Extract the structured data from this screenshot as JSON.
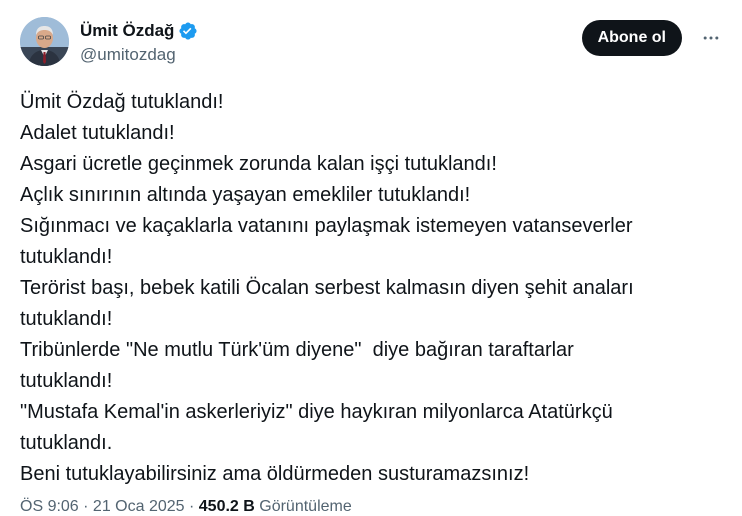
{
  "author": {
    "display_name": "Ümit Özdağ",
    "handle": "@umitozdag",
    "verified": true,
    "verified_color": "#1d9bf0"
  },
  "actions": {
    "follow_label": "Abone ol",
    "more_icon": "more-horizontal-icon"
  },
  "tweet": {
    "lines": [
      "Ümit Özdağ tutuklandı!",
      "Adalet tutuklandı!",
      "Asgari ücretle geçinmek zorunda kalan işçi tutuklandı!",
      "Açlık sınırının altında yaşayan emekliler tutuklandı!",
      "Sığınmacı ve kaçaklarla vatanını paylaşmak istemeyen vatanseverler",
      "tutuklandı!",
      "Terörist başı, bebek katili Öcalan serbest kalmasın diyen şehit anaları",
      "tutuklandı!",
      "Tribünlerde \"Ne mutlu Türk'üm diyene\"  diye bağıran taraftarlar",
      "tutuklandı!",
      "\"Mustafa Kemal'in askerleriyiz\" diye haykıran milyonlarca Atatürkçü",
      "tutuklandı.",
      "Beni tutuklayabilirsiniz ama öldürmeden susturamazsınız!"
    ]
  },
  "meta": {
    "time": "ÖS 9:06",
    "separator": " · ",
    "date": "21 Oca 2025",
    "views_count": "450.2 B",
    "views_label": " Görüntüleme"
  }
}
